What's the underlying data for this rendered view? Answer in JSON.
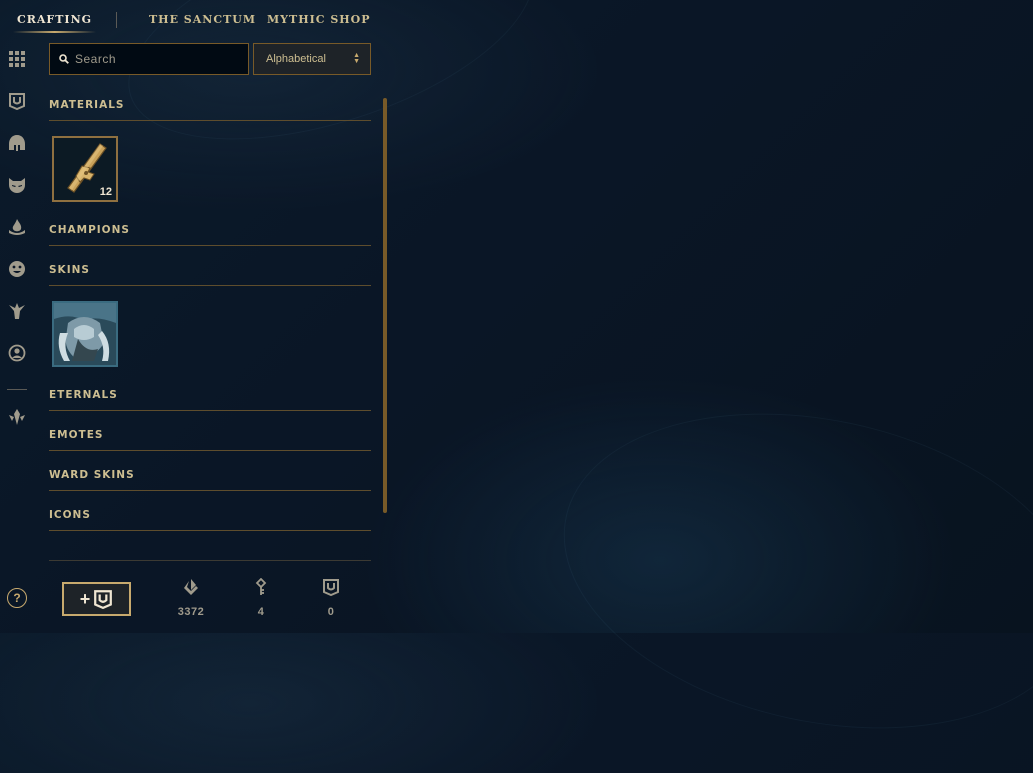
{
  "nav": {
    "tabs": [
      {
        "label": "CRAFTING",
        "active": true
      },
      {
        "label": "THE SANCTUM",
        "active": false
      },
      {
        "label": "MYTHIC SHOP",
        "active": false
      }
    ]
  },
  "rail": {
    "icons": [
      "grid-icon",
      "chest-icon",
      "helmet-icon",
      "mask-icon",
      "flame-icon",
      "emote-icon",
      "ward-icon",
      "profile-icon",
      "rune-icon"
    ],
    "help_label": "?"
  },
  "search": {
    "placeholder": "Search"
  },
  "sort": {
    "selected": "Alphabetical"
  },
  "sections": [
    {
      "label": "MATERIALS"
    },
    {
      "label": "CHAMPIONS"
    },
    {
      "label": "SKINS"
    },
    {
      "label": "ETERNALS"
    },
    {
      "label": "EMOTES"
    },
    {
      "label": "WARD SKINS"
    },
    {
      "label": "ICONS"
    }
  ],
  "items": {
    "key_fragment": {
      "count": "12",
      "icon": "key-fragment-icon"
    },
    "skin_shard": {
      "icon": "skin-shard-icon"
    }
  },
  "footer": {
    "craft_button_plus": "+",
    "blue_essence": "3372",
    "key_fragments": "4",
    "chests": "0"
  },
  "colors": {
    "gold": "#c8aa6e",
    "gold_dark": "#785a28",
    "text_gold": "#cdbe91",
    "background": "#0a1626"
  }
}
